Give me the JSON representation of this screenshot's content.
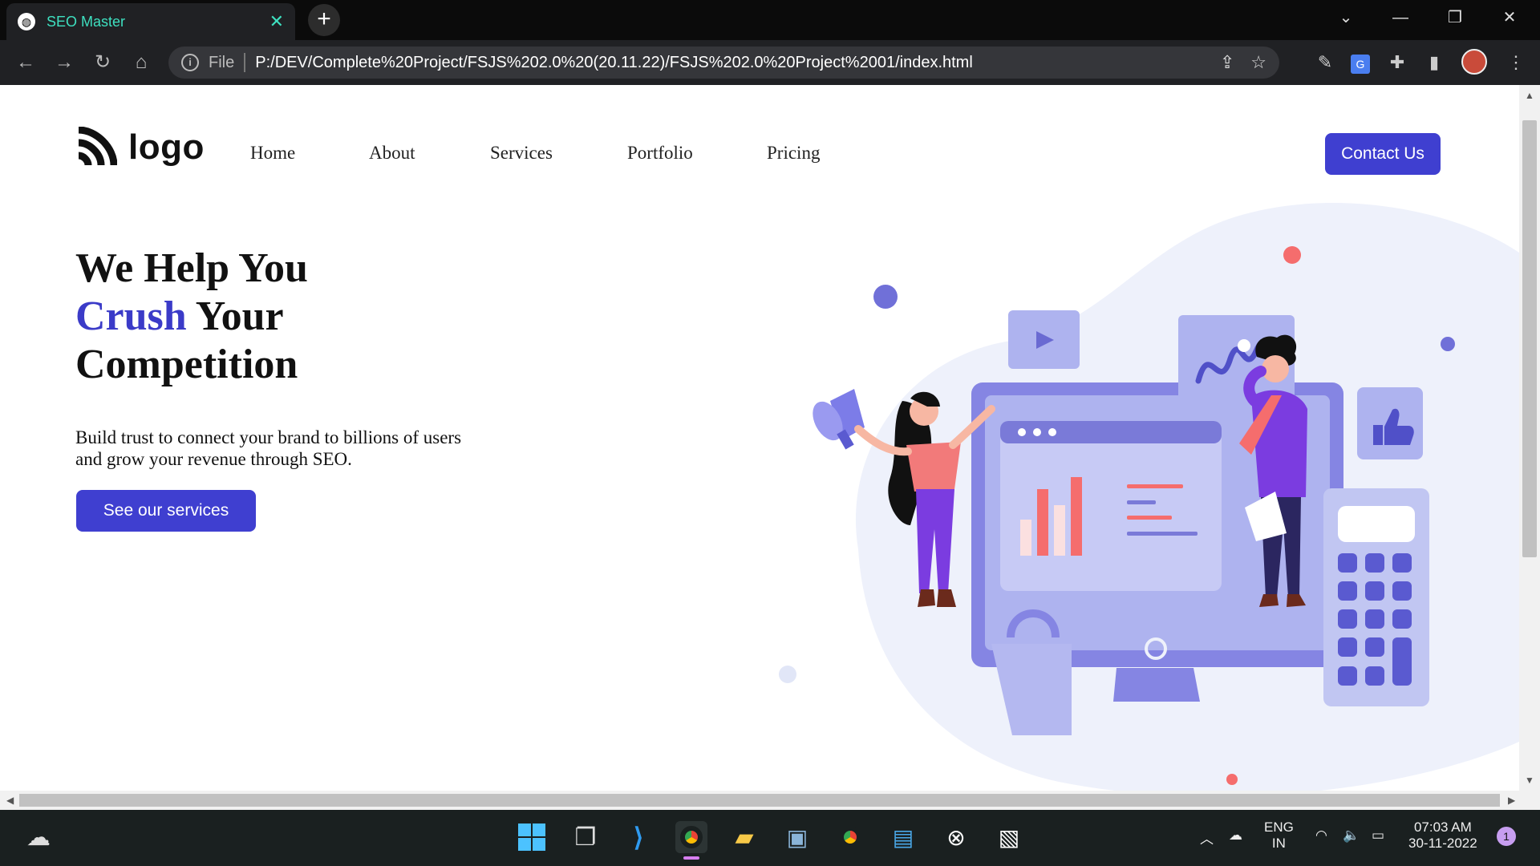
{
  "browser": {
    "tab_title": "SEO Master",
    "address_scheme": "File",
    "address_url": "P:/DEV/Complete%20Project/FSJS%202.0%20(20.11.22)/FSJS%202.0%20Project%2001/index.html"
  },
  "page": {
    "logo_text": "logo",
    "nav": [
      "Home",
      "About",
      "Services",
      "Portfolio",
      "Pricing"
    ],
    "contact_label": "Contact Us",
    "headline_line1": "We Help You",
    "headline_accent": "Crush",
    "headline_line2_rest": " Your",
    "headline_line3": "Competition",
    "subtext": "Build trust to connect your brand to billions of users and grow your revenue through SEO.",
    "cta_label": "See our services",
    "colors": {
      "accent": "#3f3fd0",
      "illustration_primary": "#7a7ae0",
      "illustration_light": "#eef1fb",
      "coral": "#f56d6d"
    }
  },
  "taskbar": {
    "lang_top": "ENG",
    "lang_bottom": "IN",
    "time": "07:03 AM",
    "date": "30-11-2022",
    "notification_count": "1"
  }
}
